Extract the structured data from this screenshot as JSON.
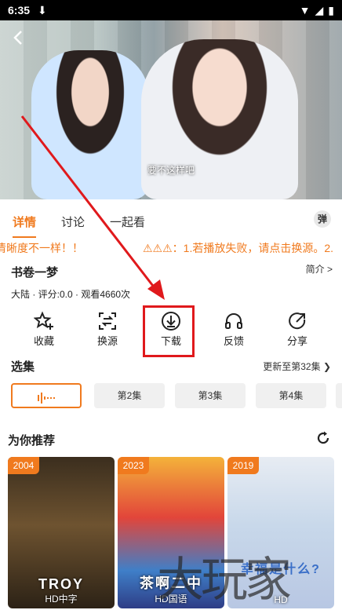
{
  "status_bar": {
    "time": "6:35"
  },
  "video": {
    "subtitle": "要不这样吧"
  },
  "tabs": [
    {
      "label": "详情",
      "active": true
    },
    {
      "label": "讨论",
      "active": false
    },
    {
      "label": "一起看",
      "active": false
    }
  ],
  "danmu": {
    "label": "弹"
  },
  "notice": {
    "left_text": "清晰度不一样！！",
    "right_text": "⚠⚠⚠：1.若播放失败，请点击换源。2."
  },
  "show": {
    "title": "书卷一梦",
    "intro": "简介 >",
    "meta": "大陆 · 评分:0.0 · 观看4660次"
  },
  "actions": [
    {
      "label": "收藏",
      "icon": "star-plus-icon"
    },
    {
      "label": "换源",
      "icon": "switch-source-icon"
    },
    {
      "label": "下载",
      "icon": "download-icon"
    },
    {
      "label": "反馈",
      "icon": "headphones-icon"
    },
    {
      "label": "分享",
      "icon": "share-icon"
    }
  ],
  "episodes": {
    "title": "选集",
    "more": "更新至第32集",
    "items": [
      "第2集",
      "第3集",
      "第4集"
    ]
  },
  "recommend": {
    "title": "为你推荐",
    "items": [
      {
        "year": "2004",
        "name": "TROY",
        "caption": "HD中字"
      },
      {
        "year": "2023",
        "name": "茶啊二中",
        "caption": "HD国语"
      },
      {
        "year": "2019",
        "name": "幸福是什么?",
        "caption": "HD"
      }
    ]
  },
  "watermark": "大玩家",
  "colors": {
    "accent": "#f07a1e",
    "highlight": "#e0191c"
  }
}
